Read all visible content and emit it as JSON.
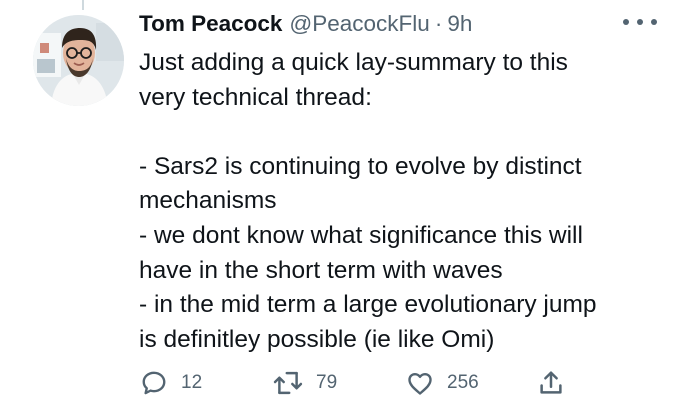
{
  "tweet": {
    "author_name": "Tom Peacock",
    "author_handle": "@PeacockFlu",
    "separator": "·",
    "time": "9h",
    "text_lines": [
      "Just adding a quick lay-summary to this",
      "very technical thread:",
      "",
      "- Sars2 is continuing to evolve by distinct",
      "mechanisms",
      "- we dont know what significance this will",
      "have in the short term with waves",
      "- in the mid term a large evolutionary jump",
      "is definitley possible (ie like Omi)"
    ]
  },
  "actions": {
    "reply_count": "12",
    "retweet_count": "79",
    "like_count": "256"
  },
  "icons": {
    "more": "more-options-icon",
    "reply": "reply-icon",
    "retweet": "retweet-icon",
    "like": "like-icon",
    "share": "share-icon"
  },
  "colors": {
    "text_primary": "#0f1419",
    "text_secondary": "#536471",
    "background": "#ffffff"
  }
}
